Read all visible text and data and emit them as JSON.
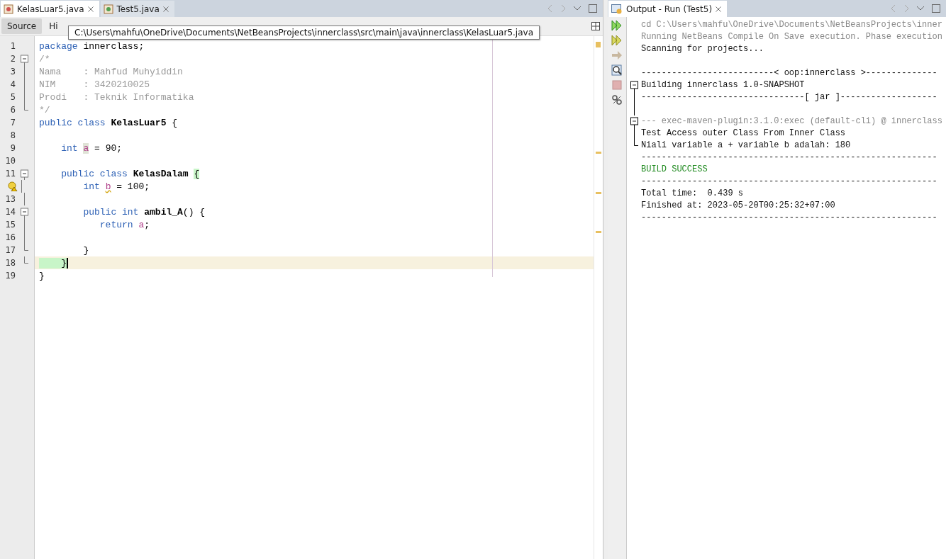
{
  "editor_tabs": [
    {
      "label": "KelasLuar5.java",
      "selected": true
    },
    {
      "label": "Test5.java",
      "selected": false
    }
  ],
  "view_tabs": [
    {
      "label": "Source",
      "selected": true
    },
    {
      "label": "Hi",
      "selected": false
    }
  ],
  "tooltip": "C:\\Users\\mahfu\\OneDrive\\Documents\\NetBeansProjects\\innerclass\\src\\main\\java\\innerclass\\KelasLuar5.java",
  "code_lines": [
    {
      "number": "1",
      "kind": "plain",
      "current": false,
      "warning": false,
      "tokens": [
        {
          "kind": "keyword",
          "text": "package"
        },
        {
          "kind": "plain",
          "text": " innerclass;"
        }
      ]
    },
    {
      "number": "2",
      "kind": "fold-start",
      "current": false,
      "warning": false,
      "tokens": [
        {
          "kind": "comment",
          "text": "/*"
        }
      ]
    },
    {
      "number": "3",
      "kind": "fold-body",
      "current": false,
      "warning": false,
      "tokens": [
        {
          "kind": "comment",
          "text": "Nama    : Mahfud Muhyiddin"
        }
      ]
    },
    {
      "number": "4",
      "kind": "fold-body",
      "current": false,
      "warning": false,
      "tokens": [
        {
          "kind": "comment",
          "text": "NIM     : 3420210025"
        }
      ]
    },
    {
      "number": "5",
      "kind": "fold-body",
      "current": false,
      "warning": false,
      "tokens": [
        {
          "kind": "comment",
          "text": "Prodi   : Teknik Informatika"
        }
      ]
    },
    {
      "number": "6",
      "kind": "fold-end",
      "current": false,
      "warning": false,
      "tokens": [
        {
          "kind": "comment",
          "text": "*/"
        }
      ]
    },
    {
      "number": "7",
      "kind": "plain",
      "current": false,
      "warning": false,
      "tokens": [
        {
          "kind": "keyword",
          "text": "public class "
        },
        {
          "kind": "bold",
          "text": "KelasLuar5"
        },
        {
          "kind": "plain",
          "text": " {"
        }
      ]
    },
    {
      "number": "8",
      "kind": "plain",
      "current": false,
      "warning": false
    },
    {
      "number": "9",
      "kind": "plain",
      "current": false,
      "warning": false,
      "tokens": [
        {
          "kind": "keyword",
          "text": "    int "
        },
        {
          "kind": "field-highlight",
          "text": "a"
        },
        {
          "kind": "plain",
          "text": " = 90;"
        }
      ]
    },
    {
      "number": "10",
      "kind": "plain",
      "current": false,
      "warning": false
    },
    {
      "number": "11",
      "kind": "fold-start",
      "current": false,
      "warning": false,
      "tokens": [
        {
          "kind": "keyword",
          "text": "    public class "
        },
        {
          "kind": "bold",
          "text": "KelasDalam "
        },
        {
          "kind": "brace-highlight",
          "text": "{"
        }
      ]
    },
    {
      "kind": "fold-body",
      "current": false,
      "warning": true,
      "tokens": [
        {
          "kind": "keyword",
          "text": "        int "
        },
        {
          "kind": "field-warning",
          "text": "b"
        },
        {
          "kind": "plain",
          "text": " = 100;"
        }
      ]
    },
    {
      "number": "13",
      "kind": "fold-body",
      "current": false,
      "warning": false
    },
    {
      "number": "14",
      "kind": "fold-start",
      "current": false,
      "warning": false,
      "tokens": [
        {
          "kind": "keyword",
          "text": "        public int "
        },
        {
          "kind": "bold",
          "text": "ambil_A"
        },
        {
          "kind": "plain",
          "text": "() {"
        }
      ]
    },
    {
      "number": "15",
      "kind": "fold-body",
      "current": false,
      "warning": false,
      "tokens": [
        {
          "kind": "keyword",
          "text": "           return "
        },
        {
          "kind": "field",
          "text": "a"
        },
        {
          "kind": "plain",
          "text": ";"
        }
      ]
    },
    {
      "number": "16",
      "kind": "fold-body",
      "current": false,
      "warning": false
    },
    {
      "number": "17",
      "kind": "fold-end",
      "current": false,
      "warning": false,
      "tokens": [
        {
          "kind": "plain",
          "text": "        }"
        }
      ]
    },
    {
      "number": "18",
      "kind": "fold-end",
      "current": true,
      "warning": false,
      "tokens": [
        {
          "kind": "brace-highlight",
          "text": "    }"
        }
      ]
    },
    {
      "number": "19",
      "kind": "plain",
      "current": false,
      "warning": false,
      "tokens": [
        {
          "kind": "plain",
          "text": "}"
        }
      ]
    }
  ],
  "output_panel": {
    "tab": {
      "label": "Output - Run (Test5)",
      "selected": true
    },
    "lines": [
      {
        "text": "cd C:\\Users\\mahfu\\OneDrive\\Documents\\NetBeansProjects\\inner",
        "kind": "plain",
        "color": "#888888"
      },
      {
        "text": "Running NetBeans Compile On Save execution. Phase execution",
        "kind": "plain",
        "color": "#888888"
      },
      {
        "text": "Scanning for projects...",
        "kind": "plain",
        "color": "#111111"
      },
      {
        "kind": "plain"
      },
      {
        "text": "--------------------------< oop:innerclass >--------------",
        "kind": "plain",
        "color": "#111111"
      },
      {
        "text": "Building innerclass 1.0-SNAPSHOT",
        "kind": "fold-start",
        "color": "#111111"
      },
      {
        "text": "--------------------------------[ jar ]-------------------",
        "kind": "fold-body",
        "color": "#111111"
      },
      {
        "kind": "fold-body"
      },
      {
        "text": "--- exec-maven-plugin:3.1.0:exec (default-cli) @ innerclass",
        "kind": "fold-start",
        "color": "#888888"
      },
      {
        "text": "Test Access outer Class From Inner Class",
        "kind": "fold-body",
        "color": "#111111"
      },
      {
        "text": "Niali variable a + variable b adalah: 180",
        "kind": "fold-end",
        "color": "#111111"
      },
      {
        "text": "----------------------------------------------------------",
        "kind": "plain"
      },
      {
        "text": "BUILD SUCCESS",
        "kind": "plain",
        "color": "#1f8a1f"
      },
      {
        "text": "----------------------------------------------------------",
        "kind": "plain"
      },
      {
        "text": "Total time:  0.439 s",
        "kind": "plain",
        "color": "#111111"
      },
      {
        "text": "Finished at: 2023-05-20T00:25:32+07:00",
        "kind": "plain",
        "color": "#111111"
      },
      {
        "text": "----------------------------------------------------------",
        "kind": "plain"
      }
    ]
  }
}
